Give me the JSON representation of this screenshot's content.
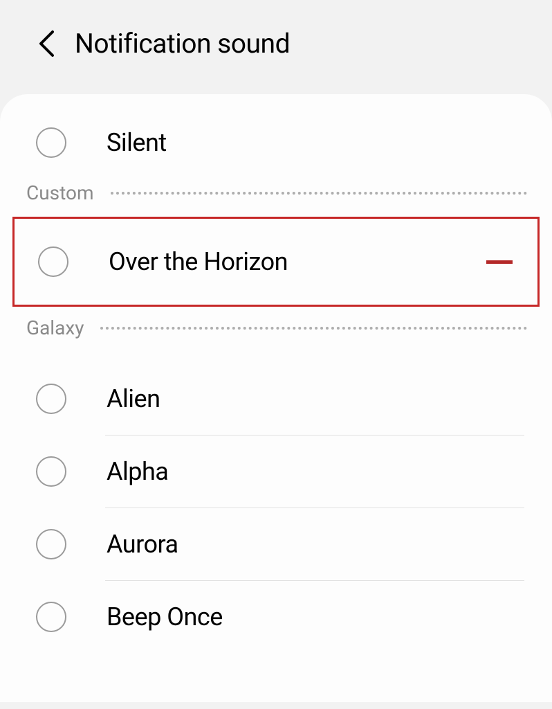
{
  "header": {
    "title": "Notification sound"
  },
  "topOption": {
    "label": "Silent"
  },
  "sections": [
    {
      "title": "Custom",
      "highlighted": true,
      "items": [
        {
          "label": "Over the Horizon",
          "removable": true
        }
      ]
    },
    {
      "title": "Galaxy",
      "items": [
        {
          "label": "Alien"
        },
        {
          "label": "Alpha"
        },
        {
          "label": "Aurora"
        },
        {
          "label": "Beep Once"
        }
      ]
    }
  ]
}
